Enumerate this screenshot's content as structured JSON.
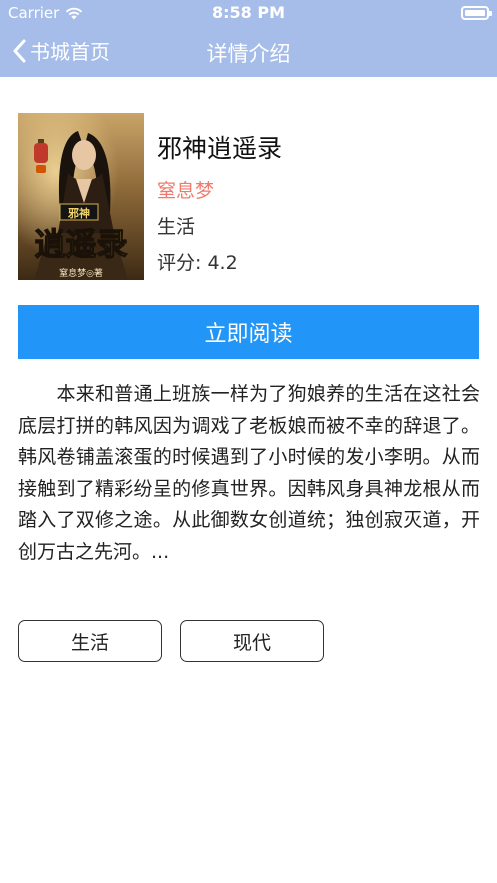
{
  "status_bar": {
    "carrier": "Carrier",
    "time": "8:58 PM",
    "icons": [
      "wifi-icon",
      "battery-icon"
    ]
  },
  "nav": {
    "back_label": "书城首页",
    "title": "详情介绍"
  },
  "book": {
    "title": "邪神逍遥录",
    "author": "窒息梦",
    "genre": "生活",
    "rating": "评分: 4.2",
    "cover_text": {
      "top": "邪神",
      "main": "逍遥录",
      "author_line": "窒息梦◎著"
    }
  },
  "actions": {
    "read_label": "立即阅读"
  },
  "description": "本来和普通上班族一样为了狗娘养的生活在这社会底层打拼的韩风因为调戏了老板娘而被不幸的辞退了。韩风卷铺盖滚蛋的时候遇到了小时候的发小李明。从而接触到了精彩纷呈的修真世界。因韩风身具神龙根从而踏入了双修之途。从此御数女创道统；独创寂灭道，开创万古之先河。...",
  "tags": [
    "生活",
    "现代"
  ],
  "colors": {
    "nav_bar": "#a6bde9",
    "primary_button": "#2196f8",
    "author": "#f07a6c"
  }
}
